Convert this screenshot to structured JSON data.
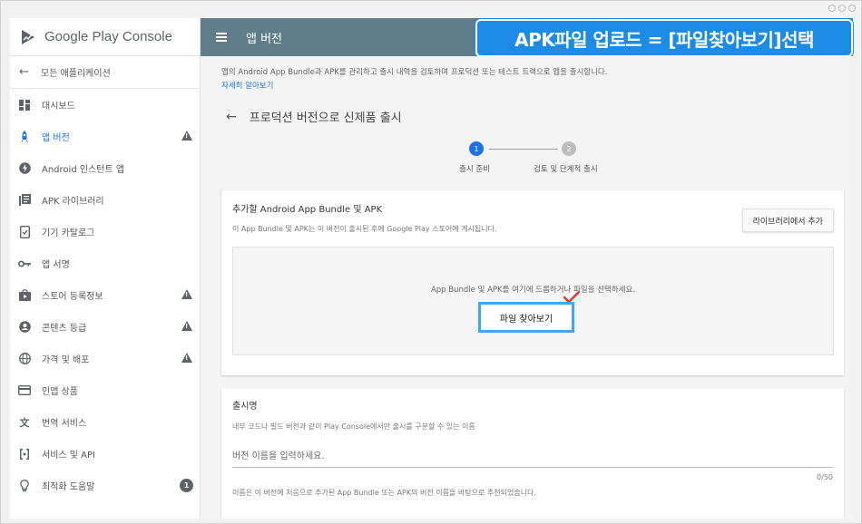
{
  "app": {
    "brand_name": "Google Play",
    "brand_suffix": "Console",
    "back_label": "모든 애플리케이션",
    "page_title": "앱 버전"
  },
  "banner": {
    "text": "APK파일 업로드 = [파일찾아보기]선택",
    "color": "#1c8be6"
  },
  "sidebar": {
    "items": [
      {
        "label": "대시보드",
        "icon": "dashboard-icon"
      },
      {
        "label": "앱 버전",
        "icon": "rocket-icon",
        "active": true,
        "warning": true
      },
      {
        "label": "Android 인스턴트 앱",
        "icon": "instant-bolt-icon"
      },
      {
        "label": "APK 라이브러리",
        "icon": "library-icon"
      },
      {
        "label": "기기 카탈로그",
        "icon": "device-catalog-icon"
      },
      {
        "label": "앱 서명",
        "icon": "key-icon"
      },
      {
        "label": "스토어 등록정보",
        "icon": "store-listing-icon",
        "warning": true
      },
      {
        "label": "콘텐츠 등급",
        "icon": "content-rating-icon",
        "warning": true
      },
      {
        "label": "가격 및 배포",
        "icon": "globe-icon",
        "warning": true
      },
      {
        "label": "인앱 상품",
        "icon": "credit-card-icon"
      },
      {
        "label": "번역 서비스",
        "icon": "translate-icon"
      },
      {
        "label": "서비스 및 API",
        "icon": "api-icon"
      },
      {
        "label": "최적화 도움말",
        "icon": "lightbulb-icon",
        "badge": "1"
      }
    ]
  },
  "main": {
    "intro_text": "앱의 Android App Bundle과 APK를 관리하고 출시 내역을 검토하며 프로덕션 또는 테스트 트랙으로 앱을 출시합니다.",
    "intro_link": "자세히 알아보기",
    "heading": "프로덕션 버전으로 신제품 출시",
    "steps": [
      {
        "num": "1",
        "label": "출시 준비"
      },
      {
        "num": "2",
        "label": "검토 및 단계적 출시"
      }
    ],
    "bundle_card": {
      "title": "추가할 Android App Bundle 및 APK",
      "subtitle": "이 App Bundle 및 APK는 이 버전이 출시된 후에 Google Play 스토어에 게시됩니다.",
      "library_button": "라이브러리에서 추가",
      "drop_text": "App Bundle 및 APK를 여기에 드롭하거나 파일을 선택하세요.",
      "browse_button": "파일 찾아보기"
    },
    "release_card": {
      "title": "출시명",
      "subtitle": "내부 코드나 빌드 버전과 같이 Play Console에서만 출시를 구분할 수 있는 이름",
      "input_placeholder": "버전 이름을 입력하세요.",
      "char_count": "0/50",
      "hint": "이름은 이 버전에 처음으로 추가된 App Bundle 또는 APK의 버전 이름을 바탕으로 추천되었습니다."
    }
  }
}
